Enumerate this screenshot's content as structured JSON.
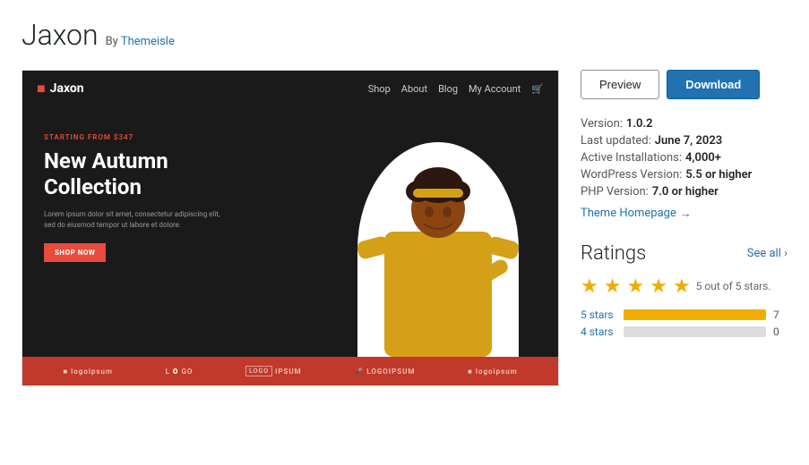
{
  "header": {
    "title": "Jaxon",
    "author_prefix": "By",
    "author_name": "Themeisle"
  },
  "action_buttons": {
    "preview_label": "Preview",
    "download_label": "Download"
  },
  "meta": {
    "version_label": "Version:",
    "version_value": "1.0.2",
    "last_updated_label": "Last updated:",
    "last_updated_value": "June 7, 2023",
    "active_installs_label": "Active Installations:",
    "active_installs_value": "4,000+",
    "wp_version_label": "WordPress Version:",
    "wp_version_value": "5.5 or higher",
    "php_version_label": "PHP Version:",
    "php_version_value": "7.0 or higher",
    "theme_homepage_label": "Theme Homepage",
    "theme_homepage_arrow": "→"
  },
  "jaxon_preview": {
    "nav": {
      "logo": "Jaxon",
      "links": [
        "Shop",
        "About",
        "Blog",
        "My Account",
        "🛒"
      ]
    },
    "hero": {
      "tag": "STARTING FROM $347",
      "heading": "New Autumn\nCollection",
      "desc": "Lorem ipsum dolor sit amet, consectetur adipiscing elit, sed do eiusmod tempor ut labore et dolore.",
      "cta": "SHOP NOW"
    },
    "logos": [
      "logoipsum",
      "LOGO",
      "LOGO IPSUM",
      "LOGOIPSUM",
      "logoipsum"
    ]
  },
  "ratings": {
    "title": "Ratings",
    "see_all_label": "See all",
    "stars_label": "5 out of 5 stars.",
    "bars": [
      {
        "label": "5 stars",
        "percent": 100,
        "count": 7
      },
      {
        "label": "4 stars",
        "percent": 0,
        "count": 0
      }
    ]
  }
}
